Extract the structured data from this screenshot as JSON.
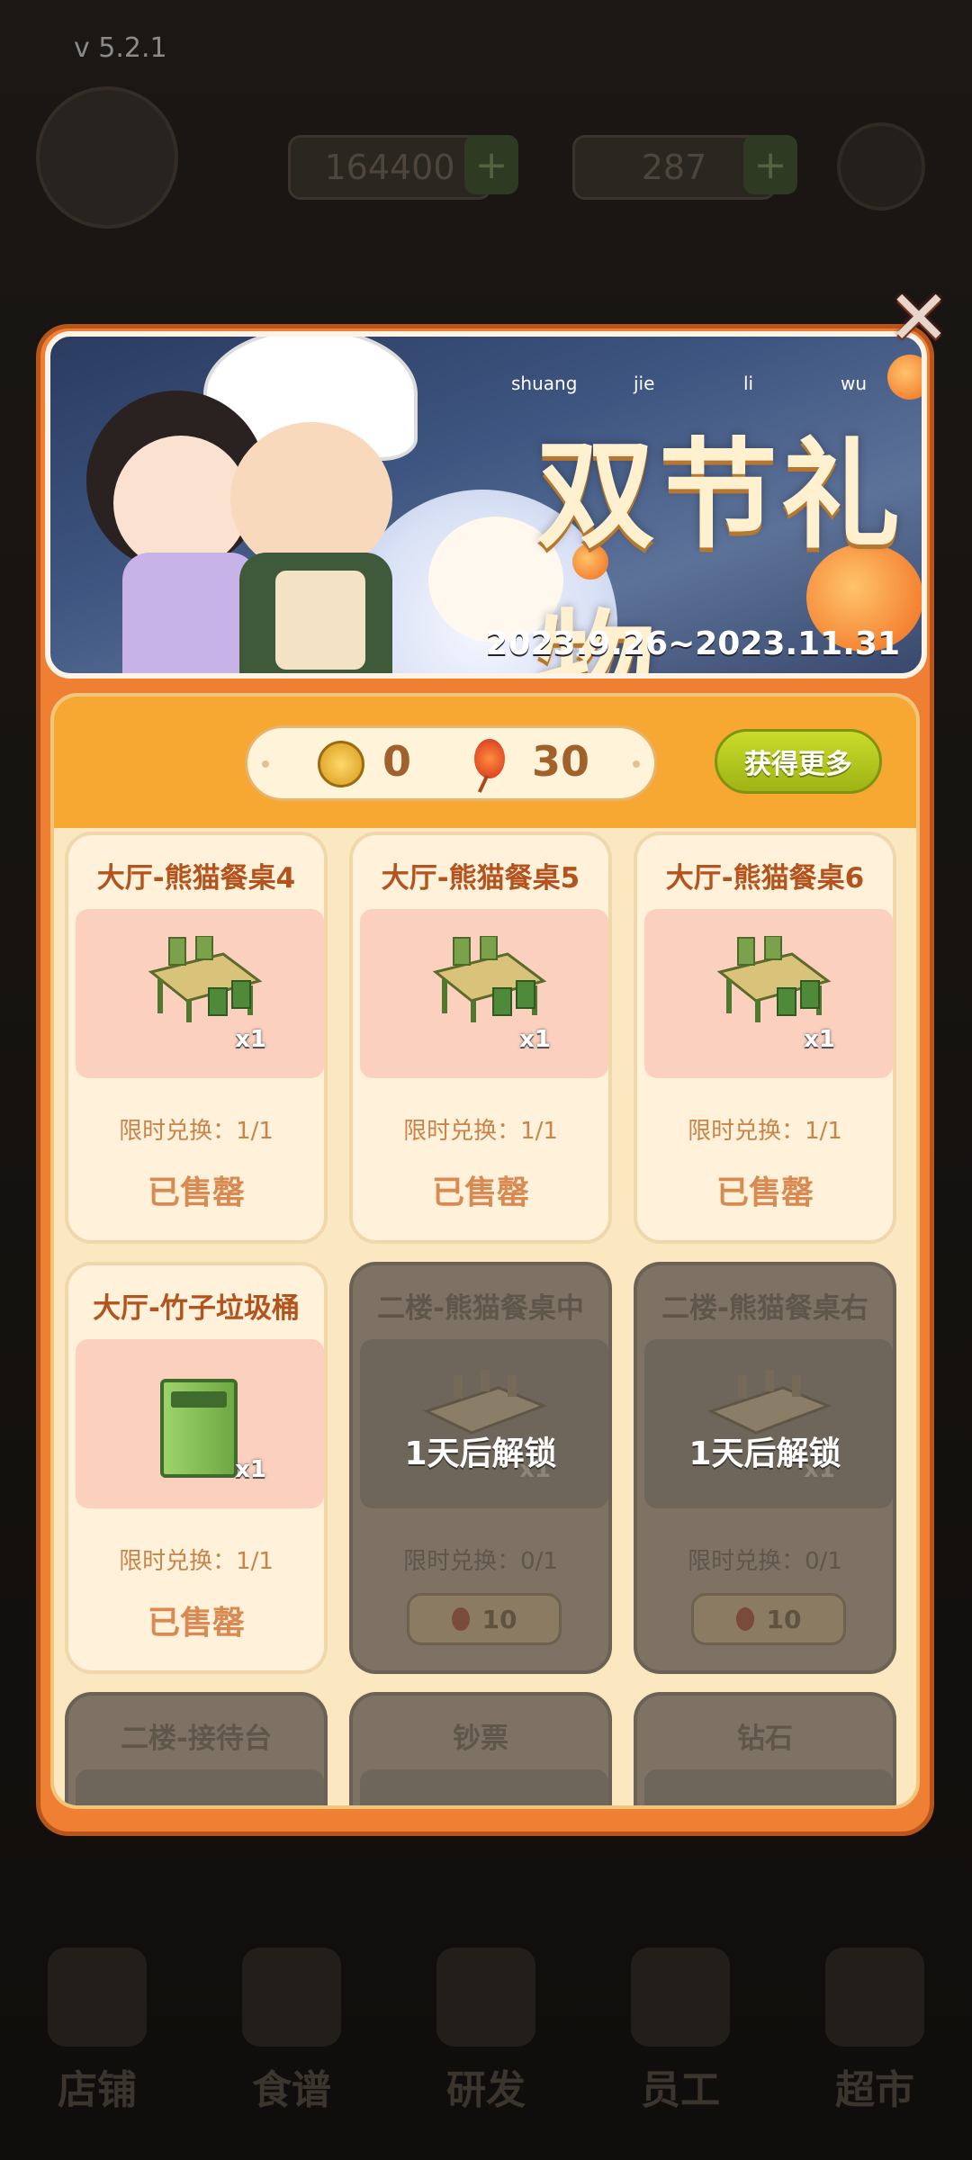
{
  "version": "v  5.2.1",
  "hud": {
    "gold": "164400",
    "gems": "287",
    "plus": "+"
  },
  "close_label": "✕",
  "banner": {
    "title": "双节礼物",
    "pinyin": [
      "shuang",
      "jie",
      "li",
      "wu"
    ],
    "date_range": "2023.9.26~2023.11.31"
  },
  "currency": {
    "coin_value": "0",
    "lantern_value": "30"
  },
  "get_more_label": "获得更多",
  "items": [
    {
      "title": "大厅-熊猫餐桌4",
      "qty": "x1",
      "limit": "限时兑换：1/1",
      "status": "已售罄",
      "locked": false,
      "icon": "bamboo-table-icon"
    },
    {
      "title": "大厅-熊猫餐桌5",
      "qty": "x1",
      "limit": "限时兑换：1/1",
      "status": "已售罄",
      "locked": false,
      "icon": "bamboo-table-icon"
    },
    {
      "title": "大厅-熊猫餐桌6",
      "qty": "x1",
      "limit": "限时兑换：1/1",
      "status": "已售罄",
      "locked": false,
      "icon": "bamboo-table-icon"
    },
    {
      "title": "大厅-竹子垃圾桶",
      "qty": "x1",
      "limit": "限时兑换：1/1",
      "status": "已售罄",
      "locked": false,
      "icon": "trash-bin-icon"
    },
    {
      "title": "二楼-熊猫餐桌中",
      "qty": "x1",
      "limit": "限时兑换：0/1",
      "unlock": "1天后解锁",
      "price": "10",
      "locked": true,
      "icon": "long-table-icon"
    },
    {
      "title": "二楼-熊猫餐桌右",
      "qty": "x1",
      "limit": "限时兑换：0/1",
      "unlock": "1天后解锁",
      "price": "10",
      "locked": true,
      "icon": "long-table-icon"
    },
    {
      "title": "二楼-接待台",
      "locked": true
    },
    {
      "title": "钞票",
      "locked": true
    },
    {
      "title": "钻石",
      "locked": true
    }
  ],
  "bottom_nav": [
    "店铺",
    "食谱",
    "研发",
    "员工",
    "超市"
  ]
}
